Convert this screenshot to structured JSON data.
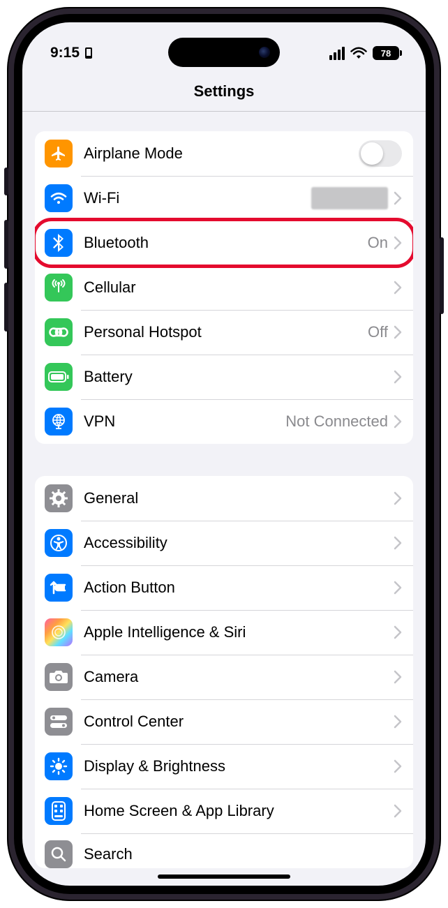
{
  "status": {
    "time": "9:15",
    "battery_pct": "78"
  },
  "header": {
    "title": "Settings"
  },
  "group1": {
    "airplane": {
      "label": "Airplane Mode",
      "toggle": false
    },
    "wifi": {
      "label": "Wi-Fi"
    },
    "bluetooth": {
      "label": "Bluetooth",
      "value": "On"
    },
    "cellular": {
      "label": "Cellular"
    },
    "hotspot": {
      "label": "Personal Hotspot",
      "value": "Off"
    },
    "battery": {
      "label": "Battery"
    },
    "vpn": {
      "label": "VPN",
      "value": "Not Connected"
    }
  },
  "group2": {
    "general": {
      "label": "General"
    },
    "accessibility": {
      "label": "Accessibility"
    },
    "action_button": {
      "label": "Action Button"
    },
    "siri": {
      "label": "Apple Intelligence & Siri"
    },
    "camera": {
      "label": "Camera"
    },
    "control_center": {
      "label": "Control Center"
    },
    "display": {
      "label": "Display & Brightness"
    },
    "home_screen": {
      "label": "Home Screen & App Library"
    },
    "search": {
      "label": "Search"
    }
  },
  "annotation": {
    "highlighted_row": "bluetooth"
  }
}
